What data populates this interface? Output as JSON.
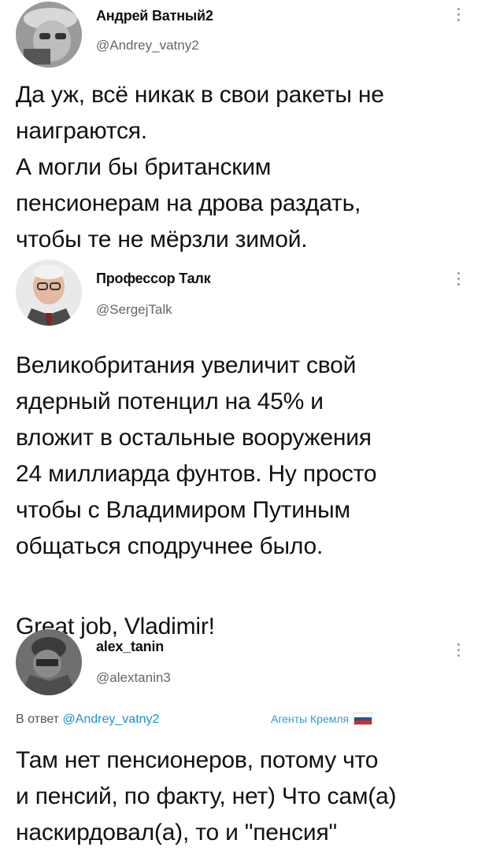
{
  "tweets": [
    {
      "name": "Андрей Ватный2",
      "handle": "@Andrey_vatny2",
      "text_lines": [
        "Да уж, всё никак в свои ракеты не",
        "наиграются.",
        "А могли бы британским",
        "пенсионерам на дрова раздать,",
        "чтобы те не мёрзли зимой."
      ]
    },
    {
      "name": "Профессор Талк",
      "handle": "@SergejTalk",
      "text_lines": [
        "Великобритания увеличит свой",
        "ядерный потенцил на 45% и",
        "вложит в остальные вооружения",
        "24 миллиарда фунтов. Ну просто",
        "чтобы с Владимиром Путиным",
        "общаться сподручнее было.",
        "",
        "Great job, Vladimir!"
      ]
    },
    {
      "name": "alex_tanin",
      "handle": "@alextanin3",
      "reply_prefix": "В ответ",
      "reply_to": "@Andrey_vatny2",
      "badge": "Агенты Кремля",
      "text_lines": [
        "Там нет пенсионеров, потому что",
        "и пенсий, по факту, нет) Что сам(а)",
        "наскирдовал(а), то и \"пенсия\""
      ]
    }
  ],
  "icons": {
    "more": "more-vertical-icon",
    "flag": "russia-flag-icon"
  },
  "colors": {
    "mention": "#1d8fd6",
    "badge": "#2e9bd9",
    "handle": "#666666",
    "text": "#111111"
  }
}
